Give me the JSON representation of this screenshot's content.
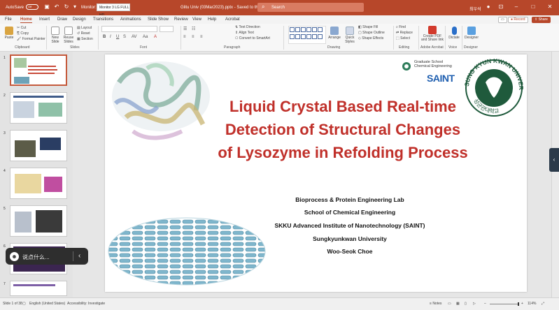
{
  "titlebar": {
    "autosave_label": "AutoSave",
    "autosave_state": "Off",
    "monitor_label": "Monitor:",
    "monitor_value": "Monitor 3 LG FULL HD",
    "filename": "Glitu Univ (03Mar2023).pptx  -  Saved to this PC",
    "search_placeholder": "Search",
    "user": "최우석",
    "accent": "#b7472a"
  },
  "tabs": [
    "File",
    "Home",
    "Insert",
    "Draw",
    "Design",
    "Transitions",
    "Animations",
    "Slide Show",
    "Review",
    "View",
    "Help",
    "Acrobat"
  ],
  "tabs_right": {
    "record": "Record",
    "share": "Share"
  },
  "ribbon": {
    "clipboard": {
      "paste": "Paste",
      "cut": "Cut",
      "copy": "Copy",
      "format_painter": "Format Painter",
      "label": "Clipboard"
    },
    "slides": {
      "new_slide": "New Slide",
      "reuse": "Reuse Slides",
      "layout": "Layout",
      "reset": "Reset",
      "section": "Section",
      "label": "Slides"
    },
    "font_label": "Font",
    "paragraph": {
      "text_direction": "Text Direction",
      "align_text": "Align Text",
      "smartart": "Convert to SmartArt",
      "label": "Paragraph"
    },
    "drawing": {
      "arrange": "Arrange",
      "quick_styles": "Quick Styles",
      "shape_fill": "Shape Fill",
      "shape_outline": "Shape Outline",
      "shape_effects": "Shape Effects",
      "label": "Drawing"
    },
    "editing": {
      "find": "Find",
      "replace": "Replace",
      "select": "Select",
      "label": "Editing"
    },
    "adobe": {
      "create": "Create PDF and Share link",
      "label": "Adobe Acrobat"
    },
    "voice": {
      "dictate": "Dictate",
      "label": "Voice"
    },
    "designer": {
      "designer": "Designer",
      "label": "Designer"
    }
  },
  "thumbnails": [
    {
      "num": "1",
      "selected": true
    },
    {
      "num": "2",
      "selected": false
    },
    {
      "num": "3",
      "selected": false
    },
    {
      "num": "4",
      "selected": false
    },
    {
      "num": "5",
      "selected": false
    },
    {
      "num": "6",
      "selected": false
    },
    {
      "num": "7",
      "selected": false
    }
  ],
  "slide": {
    "title_lines": [
      "Liquid Crystal Based Real-time",
      "Detection of Structural Changes",
      "of Lysozyme in Refolding Process"
    ],
    "title_color": "#c0302a",
    "info_lines": [
      "Bioprocess & Protein Engineering Lab",
      "School of Chemical Engineering",
      "SKKU Advanced Institute of Nanotechnology (SAINT)",
      "Sungkyunkwan University",
      "Woo-Seok Choe"
    ],
    "gs_line1": "Graduate School",
    "gs_line2": "Chemical Engineering",
    "saint": "SAINT",
    "seal_text": "SUNG KYUN KWAN UNIVERSITY",
    "seal_year": "1398",
    "seal_korean": "성균관대학교"
  },
  "float_toolbar": {
    "text": "说点什么..."
  },
  "status": {
    "slide_info": "Slide 1 of 38",
    "language": "English (United States)",
    "accessibility": "Accessibility: Investigate",
    "notes": "Notes",
    "zoom": "114%"
  }
}
